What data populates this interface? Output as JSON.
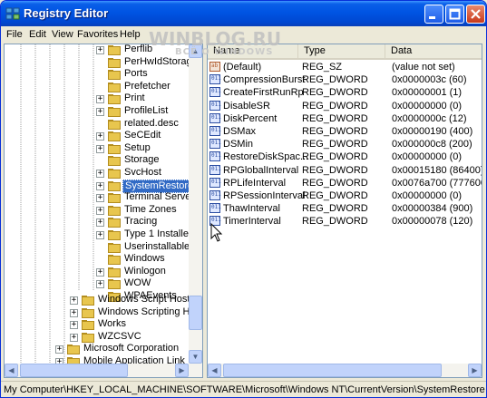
{
  "window": {
    "title": "Registry Editor",
    "watermark": "WINBLOG.RU",
    "watermark_sub": "ВСЁ О WINDOWS",
    "accent": "#316ac5"
  },
  "menubar": {
    "items": [
      "File",
      "Edit",
      "View",
      "Favorites",
      "Help"
    ]
  },
  "tree": {
    "items": [
      {
        "label": "Perflib",
        "expander": "+"
      },
      {
        "label": "PerHwIdStorage",
        "expander": ""
      },
      {
        "label": "Ports",
        "expander": ""
      },
      {
        "label": "Prefetcher",
        "expander": ""
      },
      {
        "label": "Print",
        "expander": "+"
      },
      {
        "label": "ProfileList",
        "expander": "+"
      },
      {
        "label": "related.desc",
        "expander": ""
      },
      {
        "label": "SeCEdit",
        "expander": "+"
      },
      {
        "label": "Setup",
        "expander": "+"
      },
      {
        "label": "Storage",
        "expander": ""
      },
      {
        "label": "SvcHost",
        "expander": "+"
      },
      {
        "label": "SystemRestore",
        "expander": "+",
        "selected": true
      },
      {
        "label": "Terminal Server",
        "expander": "+"
      },
      {
        "label": "Time Zones",
        "expander": "+"
      },
      {
        "label": "Tracing",
        "expander": "+"
      },
      {
        "label": "Type 1 Installer",
        "expander": "+"
      },
      {
        "label": "Userinstallable.dri",
        "expander": ""
      },
      {
        "label": "Windows",
        "expander": ""
      },
      {
        "label": "Winlogon",
        "expander": "+"
      },
      {
        "label": "WOW",
        "expander": "+"
      },
      {
        "label": "WPAEvents",
        "expander": ""
      }
    ],
    "lower_items": [
      {
        "label": "Windows Script Host",
        "expander": "+"
      },
      {
        "label": "Windows Scripting Host",
        "expander": "+"
      },
      {
        "label": "Works",
        "expander": "+"
      },
      {
        "label": "WZCSVC",
        "expander": "+"
      }
    ],
    "root_items": [
      {
        "label": "Microsoft Corporation",
        "expander": "+"
      },
      {
        "label": "Mobile Application Link",
        "expander": "+"
      }
    ]
  },
  "list": {
    "headers": {
      "name": "Name",
      "type": "Type",
      "data": "Data"
    },
    "rows": [
      {
        "name": "(Default)",
        "type": "REG_SZ",
        "data": "(value not set)",
        "icon": "string-value-icon"
      },
      {
        "name": "CompressionBurst",
        "type": "REG_DWORD",
        "data": "0x0000003c (60)",
        "icon": "binary-value-icon"
      },
      {
        "name": "CreateFirstRunRp",
        "type": "REG_DWORD",
        "data": "0x00000001 (1)",
        "icon": "binary-value-icon"
      },
      {
        "name": "DisableSR",
        "type": "REG_DWORD",
        "data": "0x00000000 (0)",
        "icon": "binary-value-icon"
      },
      {
        "name": "DiskPercent",
        "type": "REG_DWORD",
        "data": "0x0000000c (12)",
        "icon": "binary-value-icon"
      },
      {
        "name": "DSMax",
        "type": "REG_DWORD",
        "data": "0x00000190 (400)",
        "icon": "binary-value-icon"
      },
      {
        "name": "DSMin",
        "type": "REG_DWORD",
        "data": "0x000000c8 (200)",
        "icon": "binary-value-icon"
      },
      {
        "name": "RestoreDiskSpac...",
        "type": "REG_DWORD",
        "data": "0x00000000 (0)",
        "icon": "binary-value-icon"
      },
      {
        "name": "RPGlobalInterval",
        "type": "REG_DWORD",
        "data": "0x00015180 (86400)",
        "icon": "binary-value-icon"
      },
      {
        "name": "RPLifeInterval",
        "type": "REG_DWORD",
        "data": "0x0076a700 (7776000)",
        "icon": "binary-value-icon"
      },
      {
        "name": "RPSessionInterval",
        "type": "REG_DWORD",
        "data": "0x00000000 (0)",
        "icon": "binary-value-icon"
      },
      {
        "name": "ThawInterval",
        "type": "REG_DWORD",
        "data": "0x00000384 (900)",
        "icon": "binary-value-icon"
      },
      {
        "name": "TimerInterval",
        "type": "REG_DWORD",
        "data": "0x00000078 (120)",
        "icon": "binary-value-icon"
      }
    ]
  },
  "statusbar": {
    "path": "My Computer\\HKEY_LOCAL_MACHINE\\SOFTWARE\\Microsoft\\Windows NT\\CurrentVersion\\SystemRestore"
  }
}
